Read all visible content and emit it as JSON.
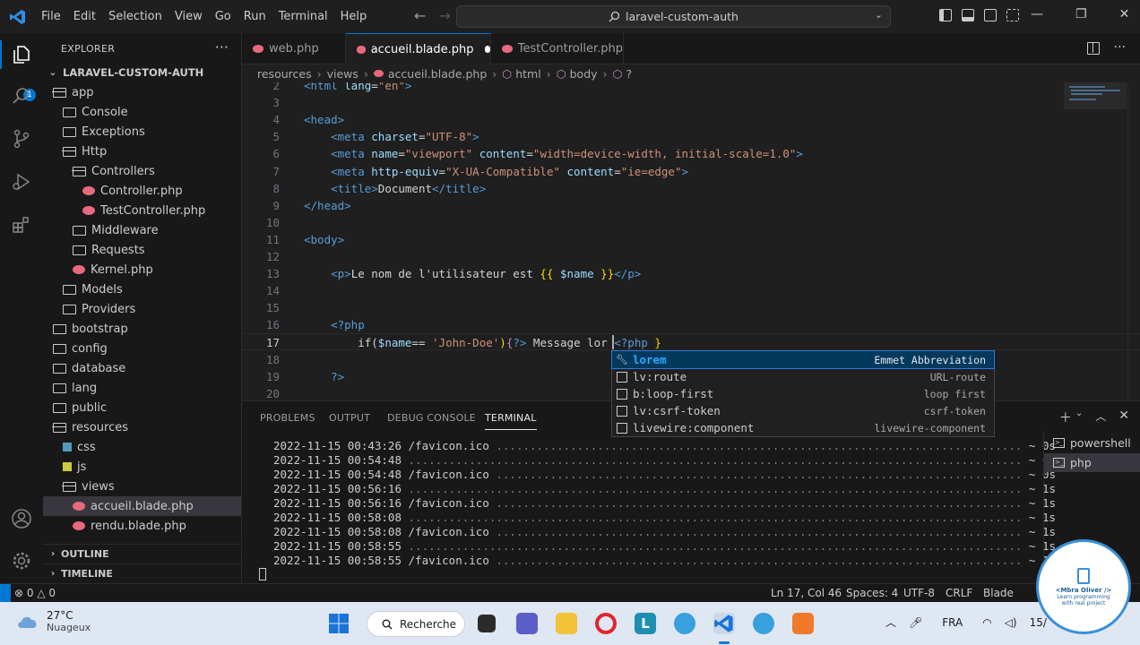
{
  "titlebar": {
    "menu": [
      "File",
      "Edit",
      "Selection",
      "View",
      "Go",
      "Run",
      "Terminal",
      "Help"
    ],
    "search": "laravel-custom-auth"
  },
  "activity": {
    "badge": "1"
  },
  "sidebar": {
    "title": "EXPLORER",
    "more": "···",
    "root": "LARAVEL-CUSTOM-AUTH",
    "tree": [
      {
        "label": "app",
        "kind": "folder-open",
        "depth": 1,
        "chev": "⌄"
      },
      {
        "label": "Console",
        "kind": "folder",
        "depth": 2,
        "chev": ""
      },
      {
        "label": "Exceptions",
        "kind": "folder",
        "depth": 2,
        "chev": ""
      },
      {
        "label": "Http",
        "kind": "folder-open",
        "depth": 2,
        "chev": ""
      },
      {
        "label": "Controllers",
        "kind": "folder-open",
        "depth": 3,
        "chev": ""
      },
      {
        "label": "Controller.php",
        "kind": "php",
        "depth": 4,
        "chev": ""
      },
      {
        "label": "TestController.php",
        "kind": "php",
        "depth": 4,
        "chev": ""
      },
      {
        "label": "Middleware",
        "kind": "folder",
        "depth": 3,
        "chev": ""
      },
      {
        "label": "Requests",
        "kind": "folder",
        "depth": 3,
        "chev": ""
      },
      {
        "label": "Kernel.php",
        "kind": "php",
        "depth": 3,
        "chev": ""
      },
      {
        "label": "Models",
        "kind": "folder",
        "depth": 2,
        "chev": ""
      },
      {
        "label": "Providers",
        "kind": "folder",
        "depth": 2,
        "chev": ""
      },
      {
        "label": "bootstrap",
        "kind": "folder",
        "depth": 1,
        "chev": ""
      },
      {
        "label": "config",
        "kind": "folder",
        "depth": 1,
        "chev": ""
      },
      {
        "label": "database",
        "kind": "folder",
        "depth": 1,
        "chev": ""
      },
      {
        "label": "lang",
        "kind": "folder",
        "depth": 1,
        "chev": ""
      },
      {
        "label": "public",
        "kind": "folder",
        "depth": 1,
        "chev": ""
      },
      {
        "label": "resources",
        "kind": "folder-open",
        "depth": 1,
        "chev": ""
      },
      {
        "label": "css",
        "kind": "css",
        "depth": 2,
        "chev": ""
      },
      {
        "label": "js",
        "kind": "js",
        "depth": 2,
        "chev": ""
      },
      {
        "label": "views",
        "kind": "folder-open",
        "depth": 2,
        "chev": ""
      },
      {
        "label": "accueil.blade.php",
        "kind": "php",
        "depth": 3,
        "chev": "",
        "selected": true
      },
      {
        "label": "rendu.blade.php",
        "kind": "php",
        "depth": 3,
        "chev": ""
      }
    ],
    "outline": "OUTLINE",
    "timeline": "TIMELINE"
  },
  "tabs": [
    {
      "label": "web.php",
      "active": false,
      "dirty": false
    },
    {
      "label": "accueil.blade.php",
      "active": true,
      "dirty": true
    },
    {
      "label": "TestController.php",
      "active": false,
      "dirty": false
    }
  ],
  "breadcrumb": [
    "resources",
    "views",
    "accueil.blade.php",
    "html",
    "body",
    "?"
  ],
  "editor": {
    "line_numbers": [
      "2",
      "3",
      "4",
      "5",
      "6",
      "7",
      "8",
      "9",
      "10",
      "11",
      "12",
      "13",
      "14",
      "15",
      "16",
      "17",
      "18",
      "19",
      "20"
    ],
    "current_line": "17",
    "lines": [
      [
        [
          "tg",
          "<html "
        ],
        [
          "at",
          "lang"
        ],
        [
          "txt",
          "="
        ],
        [
          "st",
          "\"en\""
        ],
        [
          "tg",
          ">"
        ]
      ],
      [],
      [
        [
          "tg",
          "<head>"
        ]
      ],
      [
        [
          "txt",
          "    "
        ],
        [
          "tg",
          "<meta "
        ],
        [
          "at",
          "charset"
        ],
        [
          "txt",
          "="
        ],
        [
          "st",
          "\"UTF-8\""
        ],
        [
          "tg",
          ">"
        ]
      ],
      [
        [
          "txt",
          "    "
        ],
        [
          "tg",
          "<meta "
        ],
        [
          "at",
          "name"
        ],
        [
          "txt",
          "="
        ],
        [
          "st",
          "\"viewport\""
        ],
        [
          "txt",
          " "
        ],
        [
          "at",
          "content"
        ],
        [
          "txt",
          "="
        ],
        [
          "st",
          "\"width=device-width, initial-scale=1.0\""
        ],
        [
          "tg",
          ">"
        ]
      ],
      [
        [
          "txt",
          "    "
        ],
        [
          "tg",
          "<meta "
        ],
        [
          "at",
          "http-equiv"
        ],
        [
          "txt",
          "="
        ],
        [
          "st",
          "\"X-UA-Compatible\""
        ],
        [
          "txt",
          " "
        ],
        [
          "at",
          "content"
        ],
        [
          "txt",
          "="
        ],
        [
          "st",
          "\"ie=edge\""
        ],
        [
          "tg",
          ">"
        ]
      ],
      [
        [
          "txt",
          "    "
        ],
        [
          "tg",
          "<title>"
        ],
        [
          "txt",
          "Document"
        ],
        [
          "tg",
          "</title>"
        ]
      ],
      [
        [
          "tg",
          "</head>"
        ]
      ],
      [],
      [
        [
          "tg",
          "<body>"
        ]
      ],
      [],
      [
        [
          "txt",
          "    "
        ],
        [
          "tg",
          "<p>"
        ],
        [
          "txt",
          "Le nom de l'utilisateur est "
        ],
        [
          "br",
          "{{"
        ],
        [
          "txt",
          " "
        ],
        [
          "va",
          "$name"
        ],
        [
          "txt",
          " "
        ],
        [
          "br",
          "}}"
        ],
        [
          "tg",
          "</p>"
        ]
      ],
      [],
      [],
      [
        [
          "txt",
          "    "
        ],
        [
          "tg",
          "<?php"
        ]
      ],
      [
        [
          "txt",
          "        "
        ],
        [
          "txt",
          "if("
        ],
        [
          "va",
          "$name"
        ],
        [
          "txt",
          "== "
        ],
        [
          "st",
          "'John-Doe'"
        ],
        [
          "br",
          ")"
        ],
        [
          "pk",
          "{"
        ],
        [
          "tg",
          "?>"
        ],
        [
          "txt",
          " Message lor "
        ],
        [
          "tg",
          "<?php"
        ],
        [
          "txt",
          " "
        ],
        [
          "br",
          "}"
        ]
      ],
      [],
      [
        [
          "txt",
          "    "
        ],
        [
          "tg",
          "?>"
        ]
      ],
      []
    ]
  },
  "suggest": [
    {
      "label_hl": "lor",
      "label_rest": "em",
      "detail": "Emmet Abbreviation",
      "selected": true
    },
    {
      "label_hl": "",
      "label_rest": "lv:route",
      "detail": "URL-route",
      "selected": false
    },
    {
      "label_hl": "",
      "label_rest": "b:loop-first",
      "detail": "loop first",
      "selected": false
    },
    {
      "label_hl": "",
      "label_rest": "lv:csrf-token",
      "detail": "csrf-token",
      "selected": false
    },
    {
      "label_hl": "",
      "label_rest": "livewire:component",
      "detail": "livewire-component",
      "selected": false
    }
  ],
  "panel": {
    "tabs": [
      "PROBLEMS",
      "OUTPUT",
      "DEBUG CONSOLE",
      "TERMINAL"
    ],
    "active_tab": "TERMINAL",
    "terminal_lines": [
      {
        "ts": "2022-11-15 00:43:26",
        "path": "/favicon.ico",
        "dur": "~ 0s"
      },
      {
        "ts": "2022-11-15 00:54:48",
        "path": "",
        "dur": "~ 0s"
      },
      {
        "ts": "2022-11-15 00:54:48",
        "path": "/favicon.ico",
        "dur": "~ 0s"
      },
      {
        "ts": "2022-11-15 00:56:16",
        "path": "",
        "dur": "~ 1s"
      },
      {
        "ts": "2022-11-15 00:56:16",
        "path": "/favicon.ico",
        "dur": "~ 1s"
      },
      {
        "ts": "2022-11-15 00:58:08",
        "path": "",
        "dur": "~ 1s"
      },
      {
        "ts": "2022-11-15 00:58:08",
        "path": "/favicon.ico",
        "dur": "~ 1s"
      },
      {
        "ts": "2022-11-15 00:58:55",
        "path": "",
        "dur": "~ 1s"
      },
      {
        "ts": "2022-11-15 00:58:55",
        "path": "/favicon.ico",
        "dur": "~ 1s"
      }
    ],
    "terminals": [
      {
        "label": "powershell",
        "selected": false
      },
      {
        "label": "php",
        "selected": true
      }
    ]
  },
  "statusbar": {
    "errors": "⊗ 0 △ 0",
    "position": "Ln 17, Col 46",
    "spaces": "Spaces: 4",
    "encoding": "UTF-8",
    "eol": "CRLF",
    "language": "Blade"
  },
  "taskbar": {
    "temp": "27°C",
    "condition": "Nuageux",
    "search": "Recherche",
    "lang": "FRA",
    "date": "15/"
  },
  "watermark": {
    "name": "<Mbra Oliver />",
    "tagline": "Learn programming with real project"
  }
}
